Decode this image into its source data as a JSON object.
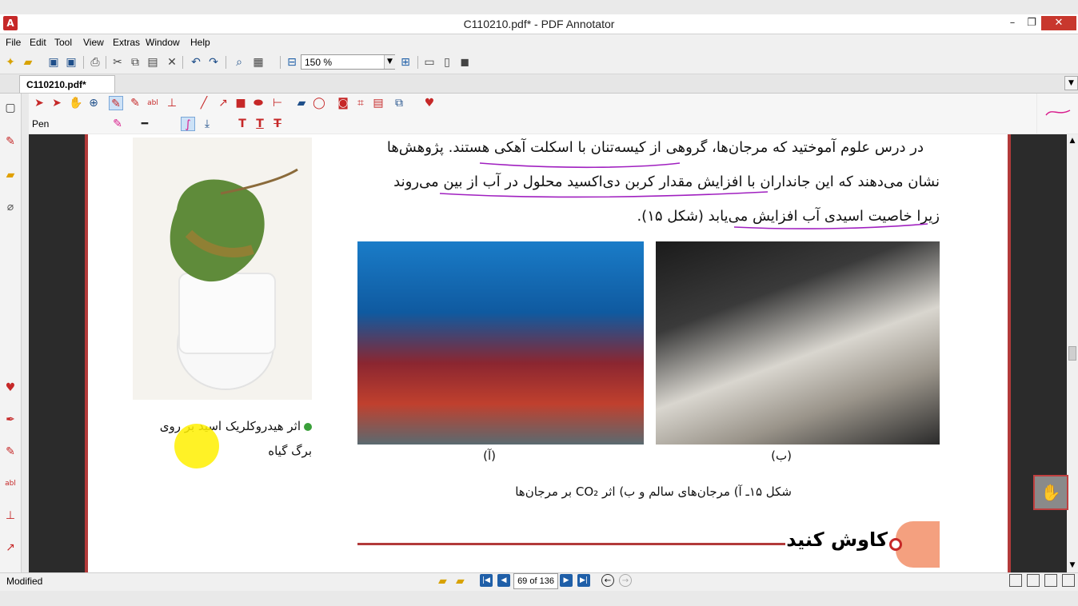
{
  "window": {
    "title": "C110210.pdf* - PDF Annotator",
    "minimize": "–",
    "maximize": "❐",
    "close": "✕"
  },
  "menu": [
    "File",
    "Edit",
    "Tool",
    "View",
    "Extras",
    "Window",
    "Help"
  ],
  "toolbar": {
    "zoom_value": "150 %"
  },
  "tab": {
    "label": "C110210.pdf*"
  },
  "pen_toolbar": {
    "label": "Pen"
  },
  "page": {
    "line1": "در درس علوم آموختید که مرجان‌ها، گروهی از کیسه‌تنان با اسکلت آهکی هستند. پژوهش‌ها",
    "line2": "نشان می‌دهند که این جانداران با افزایش مقدار کربن دی‌اکسید محلول در آب از بین می‌روند",
    "line3": "زیرا خاصیت اسیدی آب افزایش می‌یابد (شکل ۱۵).",
    "leaf_caption_1": "اثر هیدروکلریک اسید بر روی",
    "leaf_caption_2": "برگ گیاه",
    "photo_a_label": "(آ)",
    "photo_b_label": "(ب)",
    "figure_caption": "شکل ۱۵ـ آ) مرجان‌های سالم و ب) اثر CO₂ بر مرجان‌ها",
    "section_heading": "کاوش کنید"
  },
  "status": {
    "text": "Modified",
    "page_indicator": "69 of 136"
  },
  "colors": {
    "accent_red": "#c62828",
    "annotation_purple": "#a020c0",
    "nav_blue": "#1f5fa8",
    "heading_salmon": "#f4a07f"
  },
  "icons": [
    "app-logo-icon",
    "new-icon",
    "open-icon",
    "save-icon",
    "print-icon",
    "cut-icon",
    "copy-icon",
    "paste-icon",
    "delete-icon",
    "undo-icon",
    "redo-icon",
    "find-icon",
    "zoom-out-icon",
    "zoom-in-icon",
    "select-icon",
    "pen-icon",
    "highlighter-icon",
    "text-icon",
    "stamp-icon",
    "line-icon",
    "arrow-icon",
    "rectangle-icon",
    "ellipse-icon",
    "eraser-icon",
    "lasso-icon",
    "camera-icon",
    "crop-icon",
    "ruler-icon",
    "favorite-heart-icon",
    "hand-icon"
  ]
}
